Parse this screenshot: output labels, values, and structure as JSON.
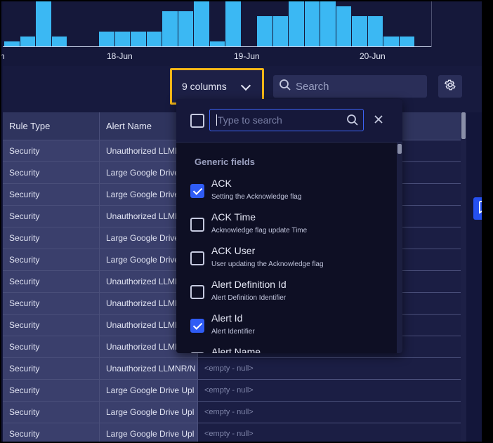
{
  "histogram": {
    "x_ticks": [
      "n",
      "18-Jun",
      "19-Jun",
      "20-Jun"
    ]
  },
  "chart_data": {
    "type": "bar",
    "title": "",
    "xlabel": "",
    "ylabel": "",
    "x_tick_labels": [
      "18-Jun",
      "19-Jun",
      "20-Jun"
    ],
    "values": [
      1,
      2,
      9,
      2,
      0,
      0,
      3,
      3,
      3,
      3,
      7,
      7,
      9,
      1,
      9,
      0,
      6,
      6,
      9,
      9,
      9,
      8,
      6,
      6,
      2,
      2
    ]
  },
  "toolbar": {
    "columns_label": "9 columns",
    "search_placeholder": "Search"
  },
  "table": {
    "columns": [
      "Rule Type",
      "Alert Name",
      ""
    ],
    "rows": [
      [
        "Security",
        "Unauthorized LLMNR/N",
        ""
      ],
      [
        "Security",
        "Large Google Drive Upl",
        ""
      ],
      [
        "Security",
        "Large Google Drive Upl",
        ""
      ],
      [
        "Security",
        "Unauthorized LLMNR/N",
        ""
      ],
      [
        "Security",
        "Large Google Drive Upl",
        ""
      ],
      [
        "Security",
        "Large Google Drive Upl",
        ""
      ],
      [
        "Security",
        "Unauthorized LLMNR/N",
        ""
      ],
      [
        "Security",
        "Unauthorized LLMNR/N",
        ""
      ],
      [
        "Security",
        "Unauthorized LLMNR/N",
        ""
      ],
      [
        "Security",
        "Unauthorized LLMNR/N",
        ""
      ],
      [
        "Security",
        "Unauthorized LLMNR/N",
        "<empty - null>"
      ],
      [
        "Security",
        "Large Google Drive Upl",
        "<empty - null>"
      ],
      [
        "Security",
        "Large Google Drive Upl",
        "<empty - null>"
      ],
      [
        "Security",
        "Large Google Drive Upl",
        "<empty - null>"
      ]
    ]
  },
  "dropdown": {
    "search_placeholder": "Type to search",
    "group_title": "Generic fields",
    "fields": [
      {
        "name": "ACK",
        "description": "Setting the Acknowledge flag",
        "checked": true
      },
      {
        "name": "ACK Time",
        "description": "Acknowledge flag update Time",
        "checked": false
      },
      {
        "name": "ACK User",
        "description": "User updating the Acknowledge flag",
        "checked": false
      },
      {
        "name": "Alert Definition Id",
        "description": "Alert Definition Identifier",
        "checked": false
      },
      {
        "name": "Alert Id",
        "description": "Alert Identifier",
        "checked": true
      },
      {
        "name": "Alert Name",
        "description": "",
        "checked": false
      }
    ]
  },
  "icons": {
    "search": "search-icon",
    "gear": "gear-icon",
    "close": "close-icon",
    "chevron": "chevron-down-icon",
    "side": "bookmark-add-icon"
  },
  "colors": {
    "bar": "#3bb8f3",
    "highlight_border": "#f2b517",
    "accent": "#2f5cf5"
  }
}
